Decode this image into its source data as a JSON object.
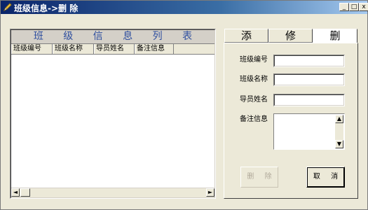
{
  "window": {
    "title": "班级信息->删  除",
    "icon": "pencil-icon",
    "controls": {
      "minimize": "_",
      "maximize": "□",
      "close": "x"
    }
  },
  "list_panel": {
    "caption": "班 级 信 息 列 表",
    "columns": [
      "班级编号",
      "班级名称",
      "导员姓名",
      "备注信息"
    ],
    "rows": [],
    "scroll_left": "◄",
    "scroll_right": "►"
  },
  "tabs": [
    {
      "label": "添 加",
      "active": false
    },
    {
      "label": "修 改",
      "active": false
    },
    {
      "label": "删 除",
      "active": true
    }
  ],
  "form": {
    "class_id_label": "班级编号",
    "class_id_value": "",
    "class_name_label": "班级名称",
    "class_name_value": "",
    "counselor_label": "导员姓名",
    "counselor_value": "",
    "remark_label": "备注信息",
    "remark_value": "",
    "scroll_up": "▲",
    "scroll_down": "▼"
  },
  "buttons": {
    "delete_label": "删 除",
    "delete_enabled": false,
    "cancel_label": "取 消"
  },
  "colors": {
    "caption_text": "#2f4f9f",
    "face": "#ece9d8",
    "title_start": "#0a246a",
    "title_end": "#a6caf0"
  }
}
